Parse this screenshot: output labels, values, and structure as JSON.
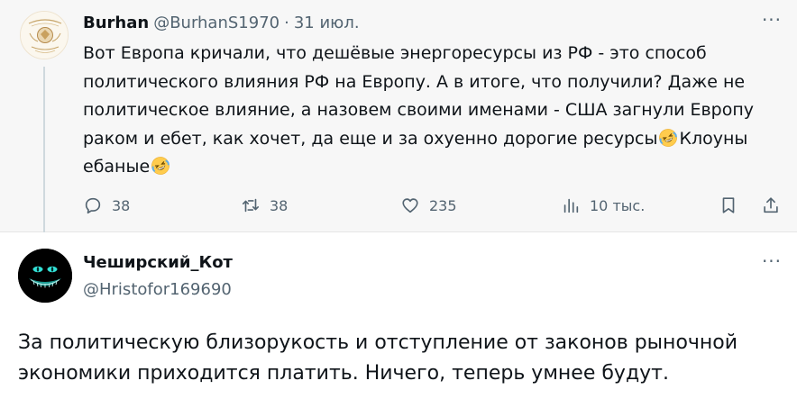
{
  "parent_tweet": {
    "author_name": "Burhan",
    "handle": "@BurhanS1970",
    "separator": "·",
    "date": "31 июл.",
    "more_label": "···",
    "text_part1": "Вот Европа кричали, что дешёвые энергоресурсы из РФ - это способ политического влияния РФ на Европу. А в итоге, что получили? Даже не политическое влияние, а назовем своими именами - США загнули Европу раком и ебет, как хочет, да еще и за охуенно дорогие ресурсы",
    "text_part2": "Клоуны ебаные",
    "emoji_icon": "rolling-on-floor-laughing-emoji",
    "actions": {
      "replies": "38",
      "retweets": "38",
      "likes": "235",
      "views": "10 тыс."
    }
  },
  "reply_tweet": {
    "author_name": "Чеширский_Кот",
    "handle": "@Hristofor169690",
    "more_label": "···",
    "text": "За политическую близорукость и отступление от законов рыночной экономики приходится платить. Ничего, теперь умнее будут."
  },
  "colors": {
    "text_primary": "#0f1419",
    "text_secondary": "#536471",
    "parent_background": "#f7f7f7",
    "thread_line": "#cfd9de"
  }
}
